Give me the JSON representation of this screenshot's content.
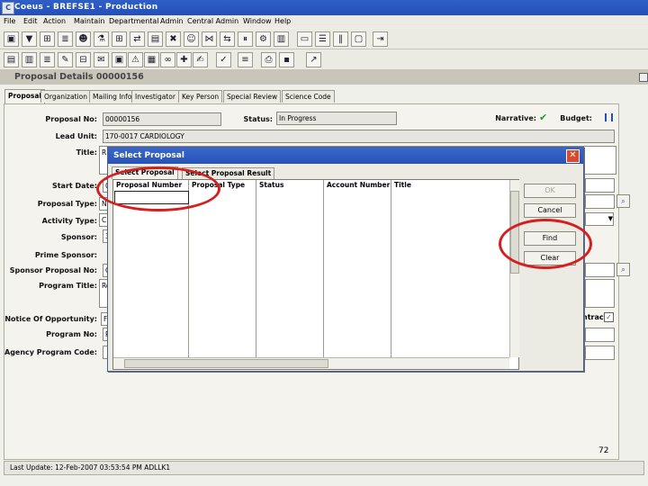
{
  "app": {
    "title": "Coeus - BREFSE1 - Production"
  },
  "menu": [
    "File",
    "Edit",
    "Action",
    "Maintain",
    "Departmental",
    "Admin",
    "Central Admin",
    "Window",
    "Help"
  ],
  "window": {
    "title": "Proposal Details 00000156"
  },
  "tabs": [
    "Proposal",
    "Organization",
    "Mailing Info",
    "Investigator",
    "Key Person",
    "Special Review",
    "Science Code"
  ],
  "form": {
    "proposal_no_label": "Proposal No:",
    "proposal_no": "00000156",
    "status_label": "Status:",
    "status": "In Progress",
    "narrative_label": "Narrative:",
    "budget_label": "Budget:",
    "lead_unit_label": "Lead Unit:",
    "lead_unit": "170-0017 CARDIOLOGY",
    "title_label": "Title:",
    "title_value": "R",
    "start_date_label": "Start Date:",
    "start_date_value": "0",
    "proposal_type_label": "Proposal Type:",
    "proposal_type_value": "N",
    "activity_type_label": "Activity Type:",
    "activity_type_value": "C",
    "sponsor_label": "Sponsor:",
    "sponsor_value": "3",
    "prime_sponsor_label": "Prime Sponsor:",
    "sponsor_proposal_no_label": "Sponsor Proposal No:",
    "sponsor_proposal_no_value": "C",
    "program_title_label": "Program Title:",
    "program_title_value": "Re",
    "notice_label": "Notice Of Opportunity:",
    "notice_value": "Fe",
    "contract_label": "ntract",
    "program_no_label": "Program No:",
    "program_no_value": "P",
    "agency_program_code_label": "Agency Program Code:"
  },
  "dialog": {
    "title": "Select Proposal",
    "tabs": [
      "Select Proposal",
      "Select Proposal Result"
    ],
    "columns": [
      "Proposal Number",
      "Proposal Type",
      "Status",
      "Account Number",
      "Title"
    ],
    "buttons": {
      "ok": "OK",
      "cancel": "Cancel",
      "find": "Find",
      "clear": "Clear"
    }
  },
  "slide_number": "72",
  "status_bar": "Last Update: 12-Feb-2007 03:53:54 PM ADLLK1",
  "colors": {
    "title_bar": "#2350b8",
    "highlight_ring": "#d51f1f"
  }
}
